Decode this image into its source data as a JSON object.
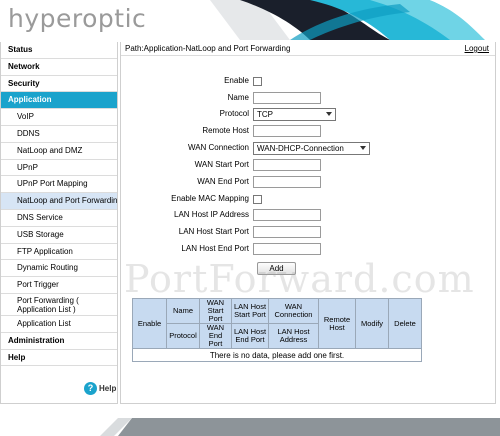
{
  "brand": {
    "logo_text": "hyperoptic"
  },
  "sidebar": {
    "items": [
      {
        "label": "Status",
        "level": "top"
      },
      {
        "label": "Network",
        "level": "top"
      },
      {
        "label": "Security",
        "level": "top"
      },
      {
        "label": "Application",
        "level": "top",
        "active": true
      },
      {
        "label": "VoIP",
        "level": "sub"
      },
      {
        "label": "DDNS",
        "level": "sub"
      },
      {
        "label": "NatLoop and DMZ",
        "level": "sub"
      },
      {
        "label": "UPnP",
        "level": "sub"
      },
      {
        "label": "UPnP Port Mapping",
        "level": "sub"
      },
      {
        "label": "NatLoop and Port Forwarding",
        "level": "sub",
        "selected": true
      },
      {
        "label": "DNS Service",
        "level": "sub"
      },
      {
        "label": "USB Storage",
        "level": "sub"
      },
      {
        "label": "FTP Application",
        "level": "sub"
      },
      {
        "label": "Dynamic Routing",
        "level": "sub"
      },
      {
        "label": "Port Trigger",
        "level": "sub"
      },
      {
        "label": "Port Forwarding ( Application List )",
        "level": "sub"
      },
      {
        "label": "Application List",
        "level": "sub"
      },
      {
        "label": "Administration",
        "level": "top"
      },
      {
        "label": "Help",
        "level": "top"
      }
    ],
    "help_label": "Help",
    "help_icon": "question-icon"
  },
  "main": {
    "path": "Path:Application-NatLoop and Port Forwarding",
    "logout": "Logout",
    "form": {
      "enable_label": "Enable",
      "name_label": "Name",
      "protocol_label": "Protocol",
      "protocol_value": "TCP",
      "remote_host_label": "Remote Host",
      "wan_connection_label": "WAN Connection",
      "wan_connection_value": "WAN-DHCP-Connection",
      "wan_start_port_label": "WAN Start Port",
      "wan_end_port_label": "WAN End Port",
      "enable_mac_label": "Enable MAC Mapping",
      "lan_ip_label": "LAN Host IP Address",
      "lan_start_port_label": "LAN Host Start Port",
      "lan_end_port_label": "LAN Host End Port",
      "add_button": "Add"
    },
    "table": {
      "headers": {
        "enable": "Enable",
        "name": "Name",
        "protocol": "Protocol",
        "wan_start": "WAN Start Port",
        "wan_end": "WAN End Port",
        "lan_start": "LAN Host Start Port",
        "lan_end": "LAN Host End Port",
        "wan_conn": "WAN Connection",
        "lan_addr": "LAN Host Address",
        "remote": "Remote Host",
        "modify": "Modify",
        "delete": "Delete"
      },
      "empty_message": "There is no data, please add one first."
    }
  },
  "watermark": "PortForward.com",
  "colors": {
    "accent": "#1ba3cc",
    "selected": "#d7e5f5",
    "table_header": "#c7daf0"
  }
}
